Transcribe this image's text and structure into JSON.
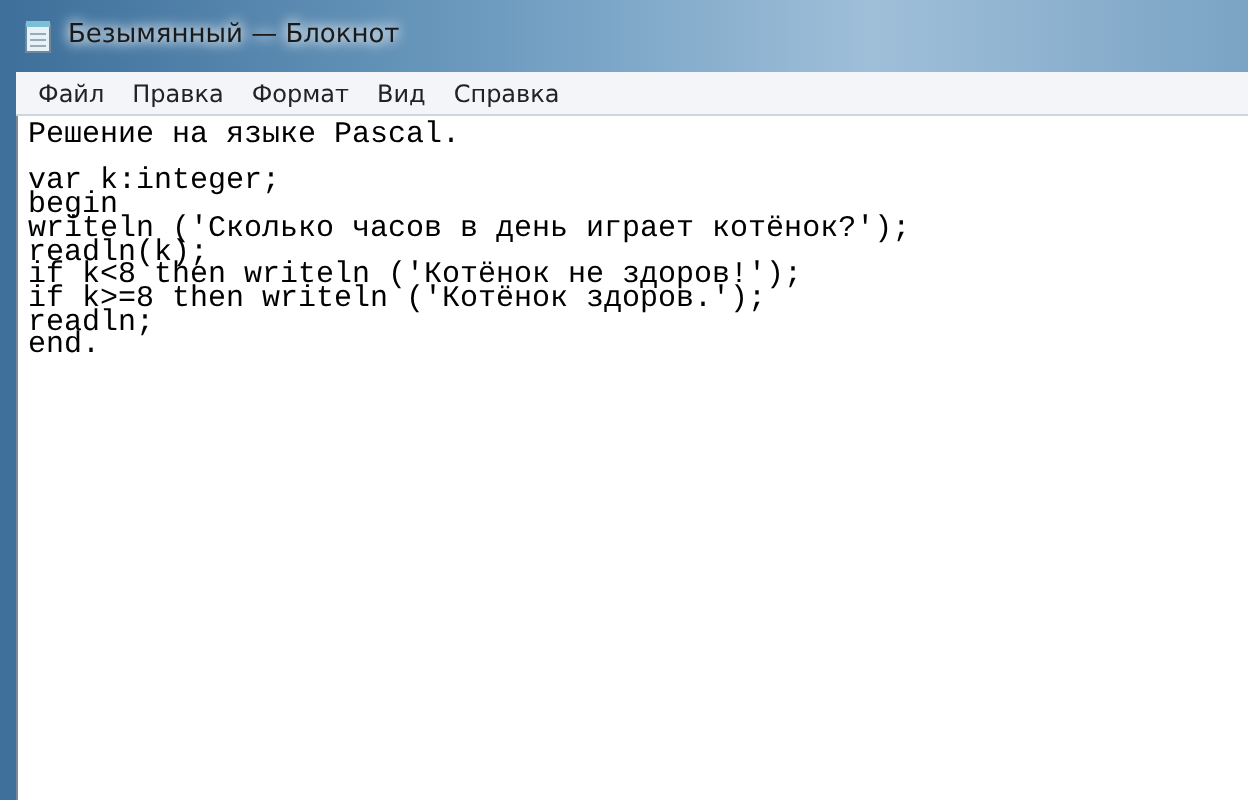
{
  "window": {
    "title": "Безымянный — Блокнот"
  },
  "menu": [
    "Файл",
    "Правка",
    "Формат",
    "Вид",
    "Справка"
  ],
  "document": {
    "text": "Решение на языке Pascal.\n\nvar k:integer;\nbegin\nwriteln ('Сколько часов в день играет котёнок?');\nreadln(k);\nif k<8 then writeln ('Котёнок не здоров!');\nif k>=8 then writeln ('Котёнок здоров.');\nreadln;\nend."
  }
}
